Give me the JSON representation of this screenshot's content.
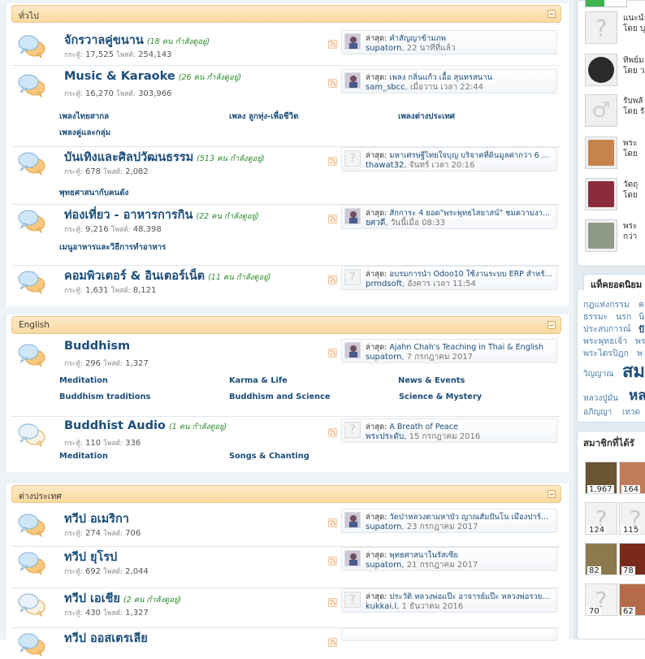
{
  "sections": [
    {
      "title": "ทั่วไป"
    },
    {
      "title": "English"
    },
    {
      "title": "ต่างประเทศ"
    }
  ],
  "labels": {
    "topics": "กระทู้:",
    "posts": "โพสต์:",
    "last": "ล่าสุด:"
  },
  "forums": [
    {
      "title": "จักรวาลคู่ขนาน",
      "online": "(18 คน กำลังดูอยู่)",
      "topics": "17,525",
      "posts": "254,143",
      "last_title": "คำสัญญาข้ามภพ",
      "last_user": "supatorn",
      "last_time": "22 นาทีที่แล้ว",
      "avatar": "user-photo"
    },
    {
      "title": "Music & Karaoke",
      "online": "(26 คน กำลังดูอยู่)",
      "topics": "16,270",
      "posts": "303,966",
      "last_title": "เพลง กลิ่นแก้ว เอื้อ สุนทรสนาน",
      "last_user": "sam_sbcc",
      "last_time": "เมื่อวาน เวลา 22:44",
      "avatar": "user-photo",
      "subforums": [
        "เพลงไทยสากล",
        "เพลง ลูกทุ่ง-เพื่อชีวิต",
        "เพลงต่างประเทศ",
        "เพลงคู่และกลุ่ม"
      ]
    },
    {
      "title": "บันเทิงและศิลปวัฒนธรรม",
      "online": "(513 คน กำลังดูอยู่)",
      "topics": "678",
      "posts": "2,082",
      "last_title": "มหาเศรษฐีไทยใจบุญ บริจาคที่ดินมูลค่ากว่า 6 ...",
      "last_user": "thawat32",
      "last_time": "จันทร์ เวลา 20:16",
      "avatar": "default",
      "subforums": [
        "พุทธศาสนากับคนดัง"
      ]
    },
    {
      "title": "ท่องเที่ยว - อาหารการกิน",
      "online": "(22 คน กำลังดูอยู่)",
      "topics": "9,216",
      "posts": "48,398",
      "last_title": "สักการะ 4 ยอด\"พระพุทธไสยาสน์\" ชมความงา...",
      "last_user": "ยศวดี",
      "last_time": "วันนี้เมื่อ 08:33",
      "avatar": "user-photo",
      "subforums": [
        "เมนูอาหารและวิธีการทำอาหาร"
      ]
    },
    {
      "title": "คอมพิวเตอร์ & อินเตอร์เน็ต",
      "online": "(11 คน กำลังดูอยู่)",
      "topics": "1,631",
      "posts": "8,121",
      "last_title": "อบรมการนำ Odoo10 ใช้งานระบบ ERP สำหรั...",
      "last_user": "prmdsoft",
      "last_time": "อังคาร เวลา 11:54",
      "avatar": "default"
    },
    {
      "title": "Buddhism",
      "online": "",
      "topics": "296",
      "posts": "1,327",
      "last_title": "Ajahn Chah's Teaching in Thai & English",
      "last_user": "supatorn",
      "last_time": "7 กรกฎาคม 2017",
      "avatar": "user-photo",
      "subforums": [
        "Meditation",
        "Karma & Life",
        "News & Events",
        "Buddhism traditions",
        "Buddhism and Science",
        "Science & Mystery"
      ]
    },
    {
      "title": "Buddhist Audio",
      "online": "(1 คน กำลังดูอยู่)",
      "topics": "110",
      "posts": "336",
      "last_title": "A Breath of Peace",
      "last_user": "พระประดับ",
      "last_time": "15 กรกฎาคม 2016",
      "avatar": "default",
      "subforums": [
        "Meditation",
        "Songs & Chanting"
      ]
    },
    {
      "title": "ทวีป อเมริกา",
      "online": "",
      "topics": "274",
      "posts": "706",
      "last_title": "วัดป่าหลวงตามหาบัว ญาณสัมปันโน เมืองปาร์...",
      "last_user": "supatorn",
      "last_time": "23 กรกฎาคม 2017",
      "avatar": "user-photo"
    },
    {
      "title": "ทวีป ยุโรป",
      "online": "",
      "topics": "692",
      "posts": "2,044",
      "last_title": "พุทธศาสนาในรัสเซีย",
      "last_user": "supatorn",
      "last_time": "21 กรกฎาคม 2017",
      "avatar": "user-photo"
    },
    {
      "title": "ทวีป เอเชีย",
      "online": "(2 คน กำลังดูอยู่)",
      "topics": "430",
      "posts": "1,327",
      "last_title": "ประวัติ หลวงพ่อแป๊ะ อาจารย์แป๊ะ หลวงพ่อรวย...",
      "last_user": "kukkai.l",
      "last_time": "1 ธันวาคม 2016",
      "avatar": "default"
    },
    {
      "title": "ทวีป ออสเตรเลีย",
      "online": "",
      "topics": "",
      "posts": "",
      "last_title": "",
      "last_user": "",
      "last_time": "",
      "avatar": "default"
    }
  ],
  "sidebar": {
    "recent": [
      {
        "line1": "แนะนำ",
        "line2": "โดย บุ"
      },
      {
        "line1": "ทิพย์ม",
        "line2": "โดย ว"
      },
      {
        "line1": "รับพลั",
        "line2": "โดย รั"
      },
      {
        "line1": "พระ",
        "line2": "โดย"
      },
      {
        "line1": "วัตถุ",
        "line2": "โดย"
      },
      {
        "line1": "พระ",
        "line2": "กว่า"
      }
    ],
    "tag_title": "แท็คยอดนิยม",
    "tags": [
      "กฎแห่งกรรม",
      "ค",
      "ธรรมะ",
      "นรก",
      "นิ",
      "ประสบการณ์",
      "ปั",
      "พระพุทธเจ้า",
      "พร",
      "พระไตรปิฎก",
      "พ",
      "วิญญาณ",
      "สม",
      "หลวงปู่มั่น",
      "หล",
      "อภิญญา",
      "เทวด"
    ],
    "members_title": "สมาชิกที่ได้รั",
    "members": [
      "1,967",
      "164",
      "124",
      "115",
      "82",
      "78",
      "70",
      "62"
    ]
  }
}
